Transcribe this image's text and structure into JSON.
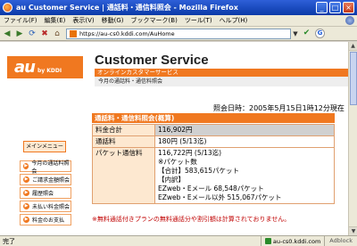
{
  "window": {
    "title": "au Customer Service | 通話料・通信料照会 - Mozilla Firefox",
    "minimize": "_",
    "maximize": "□",
    "close": "×"
  },
  "menu": [
    "ファイル(F)",
    "編集(E)",
    "表示(V)",
    "移動(G)",
    "ブックマーク(B)",
    "ツール(T)",
    "ヘルプ(H)"
  ],
  "nav": {
    "url": "https://au-cs0.kddi.com/AuHome"
  },
  "page": {
    "logo_text": "au",
    "logo_sub": "by KDDI",
    "site_title": "Customer Service",
    "banner": "オンラインカスタマーサービス",
    "subnav": "今月の通話料・通信料照会",
    "timestamp": "照会日時：2005年5月15日1時12分現在",
    "side_heading": "メインメニュー",
    "side_items": [
      "今月の通話料照会",
      "ご請求金額照会",
      "履歴照会",
      "未払い料金照会",
      "料金のお支払"
    ],
    "table_title": "通話料・通信料照会(概算)",
    "rows": [
      {
        "label": "料金合計",
        "value": "116,902円"
      },
      {
        "label": "通話料",
        "value": "180円 (5/13迄)"
      },
      {
        "label": "パケット通信料",
        "lines": [
          "116,722円 (5/13迄)",
          "※パケット数",
          "【合計】583,615パケット",
          "【内訳】",
          "EZweb・Eメール 68,548パケット",
          "EZweb・Eメール以外 515,067パケット"
        ]
      }
    ],
    "note": "※無料通話付きプランの無料通話分や割引額は計算されておりません。"
  },
  "status": {
    "text": "完了",
    "domain": "au-cs0.kddi.com",
    "adblock": "Adblock"
  }
}
